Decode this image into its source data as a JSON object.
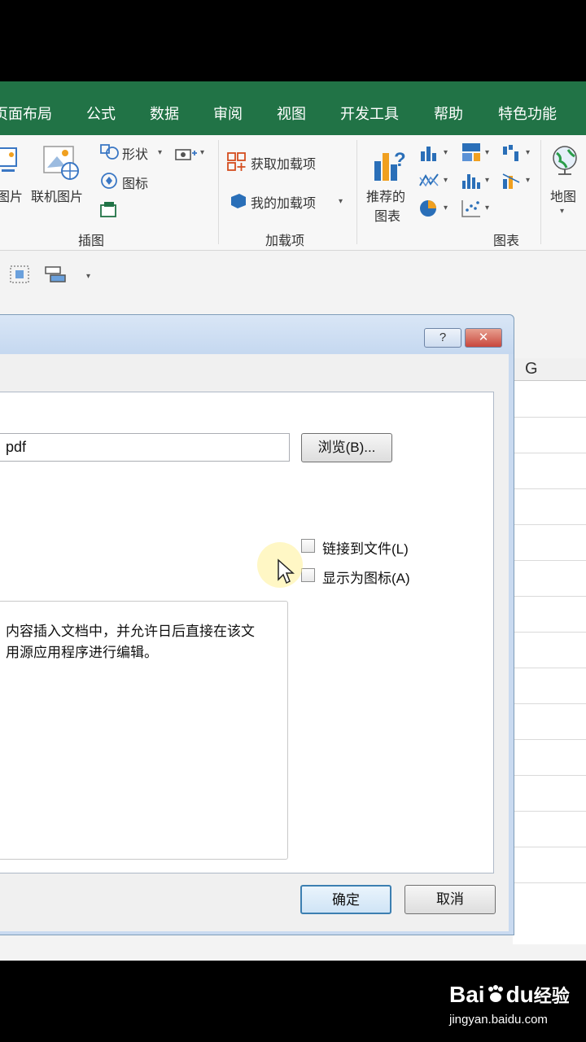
{
  "tabs": [
    "页面布局",
    "公式",
    "数据",
    "审阅",
    "视图",
    "开发工具",
    "帮助",
    "特色功能"
  ],
  "ribbon": {
    "pictures_label": "图片",
    "online_pictures_label": "联机图片",
    "shapes_label": "形状",
    "icons_label": "图标",
    "group_illustrations": "插图",
    "get_addins_label": "获取加载项",
    "my_addins_label": "我的加载项",
    "group_addins": "加载项",
    "recommended_charts_line1": "推荐的",
    "recommended_charts_line2": "图表",
    "group_charts": "图表",
    "maps_label": "地图"
  },
  "sheet": {
    "column_g": "G"
  },
  "dialog": {
    "help_button": "?",
    "close_button": "✕",
    "file_value": "pdf",
    "browse_button": "浏览(B)...",
    "link_to_file": "链接到文件(L)",
    "display_as_icon": "显示为图标(A)",
    "result_line1": "内容插入文档中，并允许日后直接在该文",
    "result_line2": "用源应用程序进行编辑。",
    "ok_button": "确定",
    "cancel_button": "取消"
  },
  "watermark": {
    "brand_left": "Bai",
    "brand_mid": "du",
    "brand_right": "经验",
    "url": "jingyan.baidu.com"
  },
  "colors": {
    "excel_green": "#217346",
    "dialog_blue": "#c9daf0",
    "close_red": "#c8473c"
  }
}
